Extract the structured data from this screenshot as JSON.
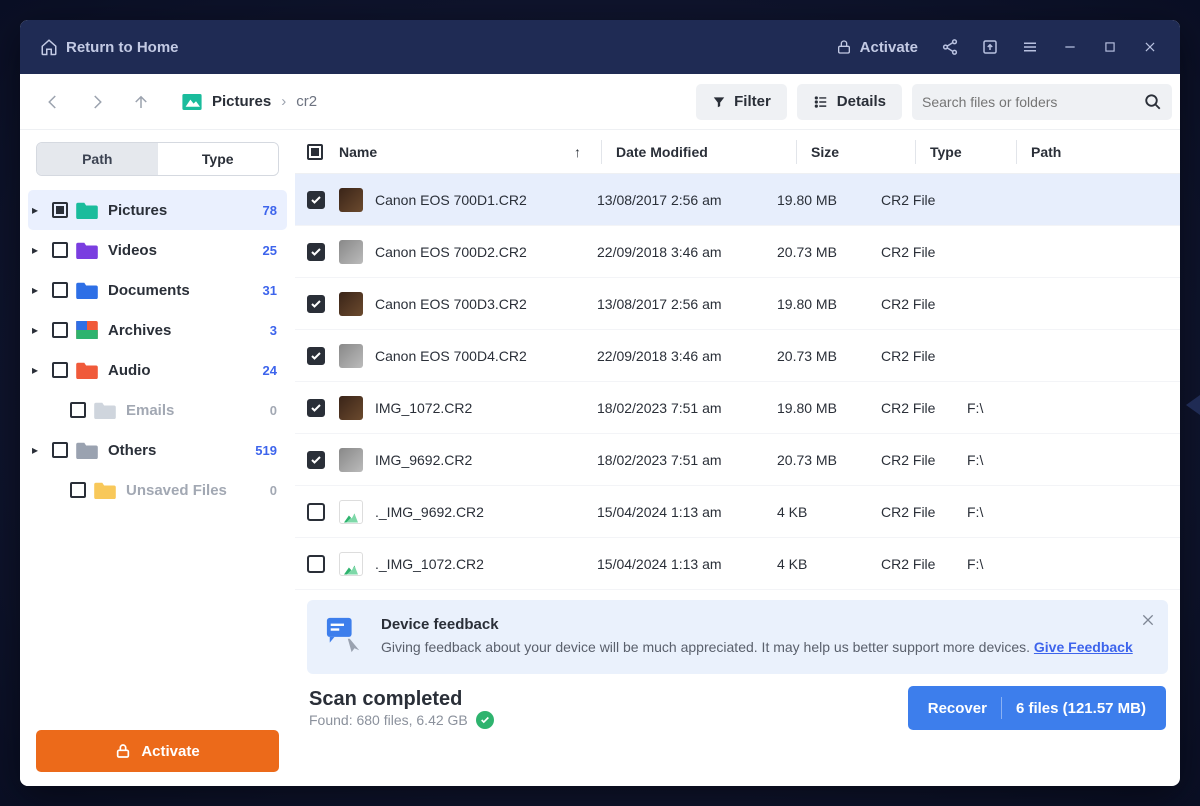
{
  "titlebar": {
    "home_label": "Return to Home",
    "activate_label": "Activate"
  },
  "toolbar": {
    "breadcrumb": [
      "Pictures",
      "cr2"
    ],
    "filter_label": "Filter",
    "details_label": "Details",
    "search_placeholder": "Search files or folders"
  },
  "sidebar": {
    "tabs": {
      "path": "Path",
      "type": "Type"
    },
    "items": [
      {
        "label": "Pictures",
        "count": "78",
        "color": "#1abc9c",
        "hasArrow": true,
        "indet": true,
        "active": true
      },
      {
        "label": "Videos",
        "count": "25",
        "color": "#7a3ee0",
        "hasArrow": true
      },
      {
        "label": "Documents",
        "count": "31",
        "color": "#2e6fe6",
        "hasArrow": true
      },
      {
        "label": "Archives",
        "count": "3",
        "color_multi": true,
        "hasArrow": true
      },
      {
        "label": "Audio",
        "count": "24",
        "color": "#f05a3a",
        "hasArrow": true
      },
      {
        "label": "Emails",
        "count": "0",
        "color": "#cfd5dd",
        "muted": true
      },
      {
        "label": "Others",
        "count": "519",
        "color": "#9aa2b0",
        "hasArrow": true
      },
      {
        "label": "Unsaved Files",
        "count": "0",
        "color": "#f8c85a",
        "muted": true
      }
    ],
    "activate_label": "Activate"
  },
  "columns": {
    "name": "Name",
    "date": "Date Modified",
    "size": "Size",
    "type": "Type",
    "path": "Path"
  },
  "files": [
    {
      "name": "Canon EOS 700D1.CR2",
      "date": "13/08/2017 2:56 am",
      "size": "19.80 MB",
      "type": "CR2 File",
      "path": "",
      "checked": true,
      "thumb": "dark",
      "sel": true
    },
    {
      "name": "Canon EOS 700D2.CR2",
      "date": "22/09/2018 3:46 am",
      "size": "20.73 MB",
      "type": "CR2 File",
      "path": "",
      "checked": true,
      "thumb": "gray"
    },
    {
      "name": "Canon EOS 700D3.CR2",
      "date": "13/08/2017 2:56 am",
      "size": "19.80 MB",
      "type": "CR2 File",
      "path": "",
      "checked": true,
      "thumb": "dark"
    },
    {
      "name": "Canon EOS 700D4.CR2",
      "date": "22/09/2018 3:46 am",
      "size": "20.73 MB",
      "type": "CR2 File",
      "path": "",
      "checked": true,
      "thumb": "gray"
    },
    {
      "name": "IMG_1072.CR2",
      "date": "18/02/2023 7:51 am",
      "size": "19.80 MB",
      "type": "CR2 File",
      "path": "F:\\",
      "checked": true,
      "thumb": "dark"
    },
    {
      "name": "IMG_9692.CR2",
      "date": "18/02/2023 7:51 am",
      "size": "20.73 MB",
      "type": "CR2 File",
      "path": "F:\\",
      "checked": true,
      "thumb": "gray"
    },
    {
      "name": "._IMG_9692.CR2",
      "date": "15/04/2024 1:13 am",
      "size": "4 KB",
      "type": "CR2 File",
      "path": "F:\\",
      "checked": false,
      "thumb": "img"
    },
    {
      "name": "._IMG_1072.CR2",
      "date": "15/04/2024 1:13 am",
      "size": "4 KB",
      "type": "CR2 File",
      "path": "F:\\",
      "checked": false,
      "thumb": "img"
    }
  ],
  "feedback": {
    "title": "Device feedback",
    "text": "Giving feedback about your device will be much appreciated. It may help us better support more devices. ",
    "link": "Give Feedback"
  },
  "status": {
    "title": "Scan completed",
    "subtitle": "Found: 680 files, 6.42 GB"
  },
  "recover": {
    "label": "Recover",
    "summary": "6 files (121.57 MB)"
  }
}
